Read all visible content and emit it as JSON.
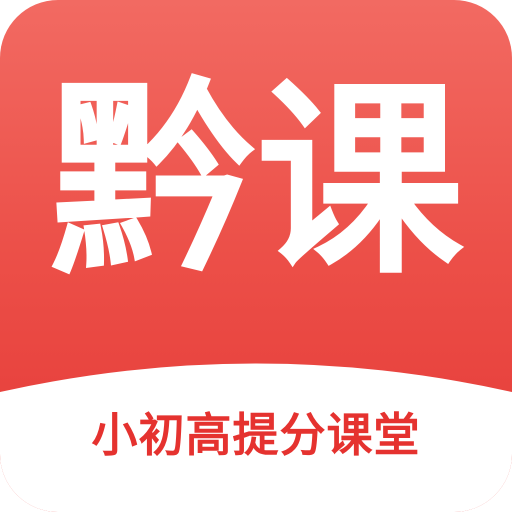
{
  "app_icon": {
    "title": "黔课",
    "slogan": "小初高提分课堂"
  },
  "colors": {
    "brand_red": "#ec4f48",
    "brand_red_light": "#f26a62",
    "brand_red_dark": "#e53936",
    "text_on_brand": "#ffffff",
    "slogan_text": "#e5322f",
    "base_white": "#ffffff"
  }
}
